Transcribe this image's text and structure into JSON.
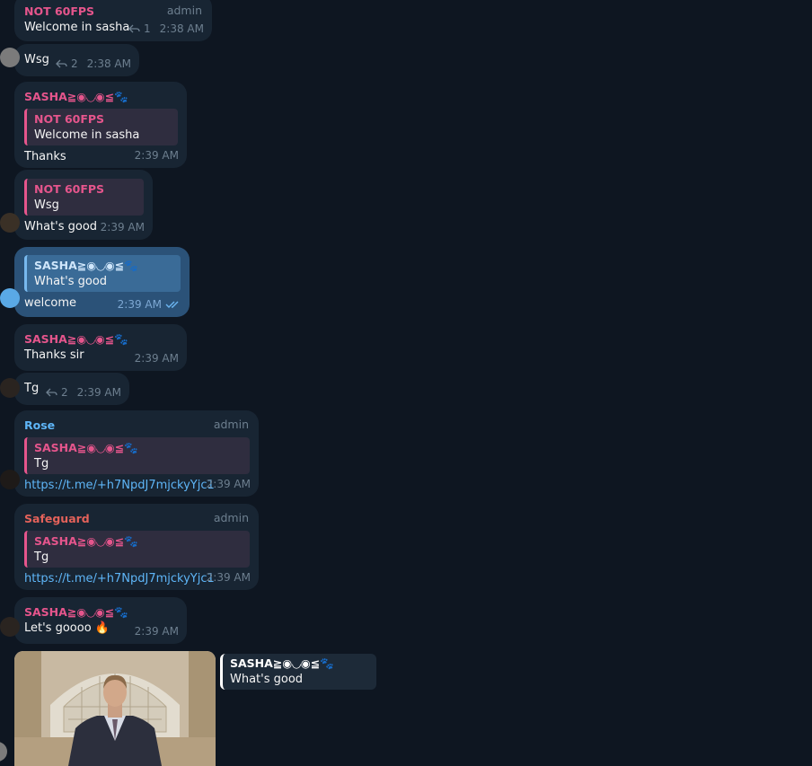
{
  "messages": {
    "m1": {
      "sender": "NOT 60FPS",
      "role": "admin",
      "text": "Welcome in sasha",
      "reply_count": "1",
      "time": "2:38 AM"
    },
    "m2": {
      "text": "Wsg",
      "reply_count": "2",
      "time": "2:38 AM"
    },
    "m3": {
      "sender": "SASHA≧◉◡◉≦🐾",
      "quote_name": "NOT 60FPS",
      "quote_text": "Welcome in sasha",
      "text": "Thanks",
      "time": "2:39 AM"
    },
    "m4": {
      "quote_name": "NOT 60FPS",
      "quote_text": "Wsg",
      "text": "What's good",
      "time": "2:39 AM"
    },
    "m5": {
      "quote_name": "SASHA≧◉◡◉≦🐾",
      "quote_text": "What's good",
      "text": "welcome",
      "time": "2:39 AM"
    },
    "m6": {
      "sender": "SASHA≧◉◡◉≦🐾",
      "text": "Thanks sir",
      "time": "2:39 AM"
    },
    "m7": {
      "text": "Tg",
      "reply_count": "2",
      "time": "2:39 AM"
    },
    "m8": {
      "sender": "Rose",
      "role": "admin",
      "quote_name": "SASHA≧◉◡◉≦🐾",
      "quote_text": "Tg",
      "text": "https://t.me/+h7NpdJ7mjckyYjc1",
      "time": "2:39 AM"
    },
    "m9": {
      "sender": "Safeguard",
      "role": "admin",
      "quote_name": "SASHA≧◉◡◉≦🐾",
      "quote_text": "Tg",
      "text": "https://t.me/+h7NpdJ7mjckyYjc1",
      "time": "2:39 AM"
    },
    "m10": {
      "sender": "SASHA≧◉◡◉≦🐾",
      "text": "Let's goooo 🔥",
      "time": "2:39 AM"
    },
    "m11": {
      "quote_name": "SASHA≧◉◡◉≦🐾",
      "quote_text": "What's good"
    }
  },
  "colors": {
    "background": "#0e1621",
    "bubble_in": "#182533",
    "bubble_out": "#2b5278",
    "accent_pink": "#e5558c",
    "accent_blue": "#5eb5f7"
  }
}
